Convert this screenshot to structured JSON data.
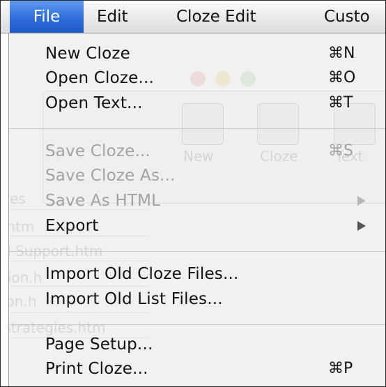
{
  "menubar": {
    "items": [
      {
        "label": "File",
        "active": true
      },
      {
        "label": "Edit",
        "active": false
      },
      {
        "label": "Cloze Edit",
        "active": false
      },
      {
        "label": "Custo",
        "active": false
      }
    ]
  },
  "file_menu": {
    "groups": [
      [
        {
          "label": "New Cloze",
          "shortcut": "⌘N",
          "enabled": true
        },
        {
          "label": "Open Cloze...",
          "shortcut": "⌘O",
          "enabled": true
        },
        {
          "label": "Open Text...",
          "shortcut": "⌘T",
          "enabled": true
        }
      ],
      [
        {
          "label": "Save Cloze...",
          "shortcut": "⌘S",
          "enabled": false
        },
        {
          "label": "Save Cloze As...",
          "shortcut": "",
          "enabled": false
        },
        {
          "label": "Save As HTML",
          "shortcut": "",
          "enabled": false,
          "submenu": true
        },
        {
          "label": "Export",
          "shortcut": "",
          "enabled": true,
          "submenu": true
        }
      ],
      [
        {
          "label": "Import Old Cloze Files...",
          "shortcut": "",
          "enabled": true
        },
        {
          "label": "Import Old List Files...",
          "shortcut": "",
          "enabled": true
        }
      ],
      [
        {
          "label": "Page Setup...",
          "shortcut": "",
          "enabled": true
        },
        {
          "label": "Print Cloze...",
          "shortcut": "⌘P",
          "enabled": true
        }
      ]
    ]
  },
  "background_window": {
    "toolbar_labels": [
      "New",
      "Cloze",
      "Text"
    ],
    "file_list": [
      "iles",
      ".htm",
      "d Support.htm",
      "tion.h",
      "ion.h",
      "Strategies.htm"
    ]
  },
  "colors": {
    "menu_highlight": "#2a69d9",
    "disabled_text": "#a3a3a3",
    "menu_background": "#f1f1f1"
  }
}
